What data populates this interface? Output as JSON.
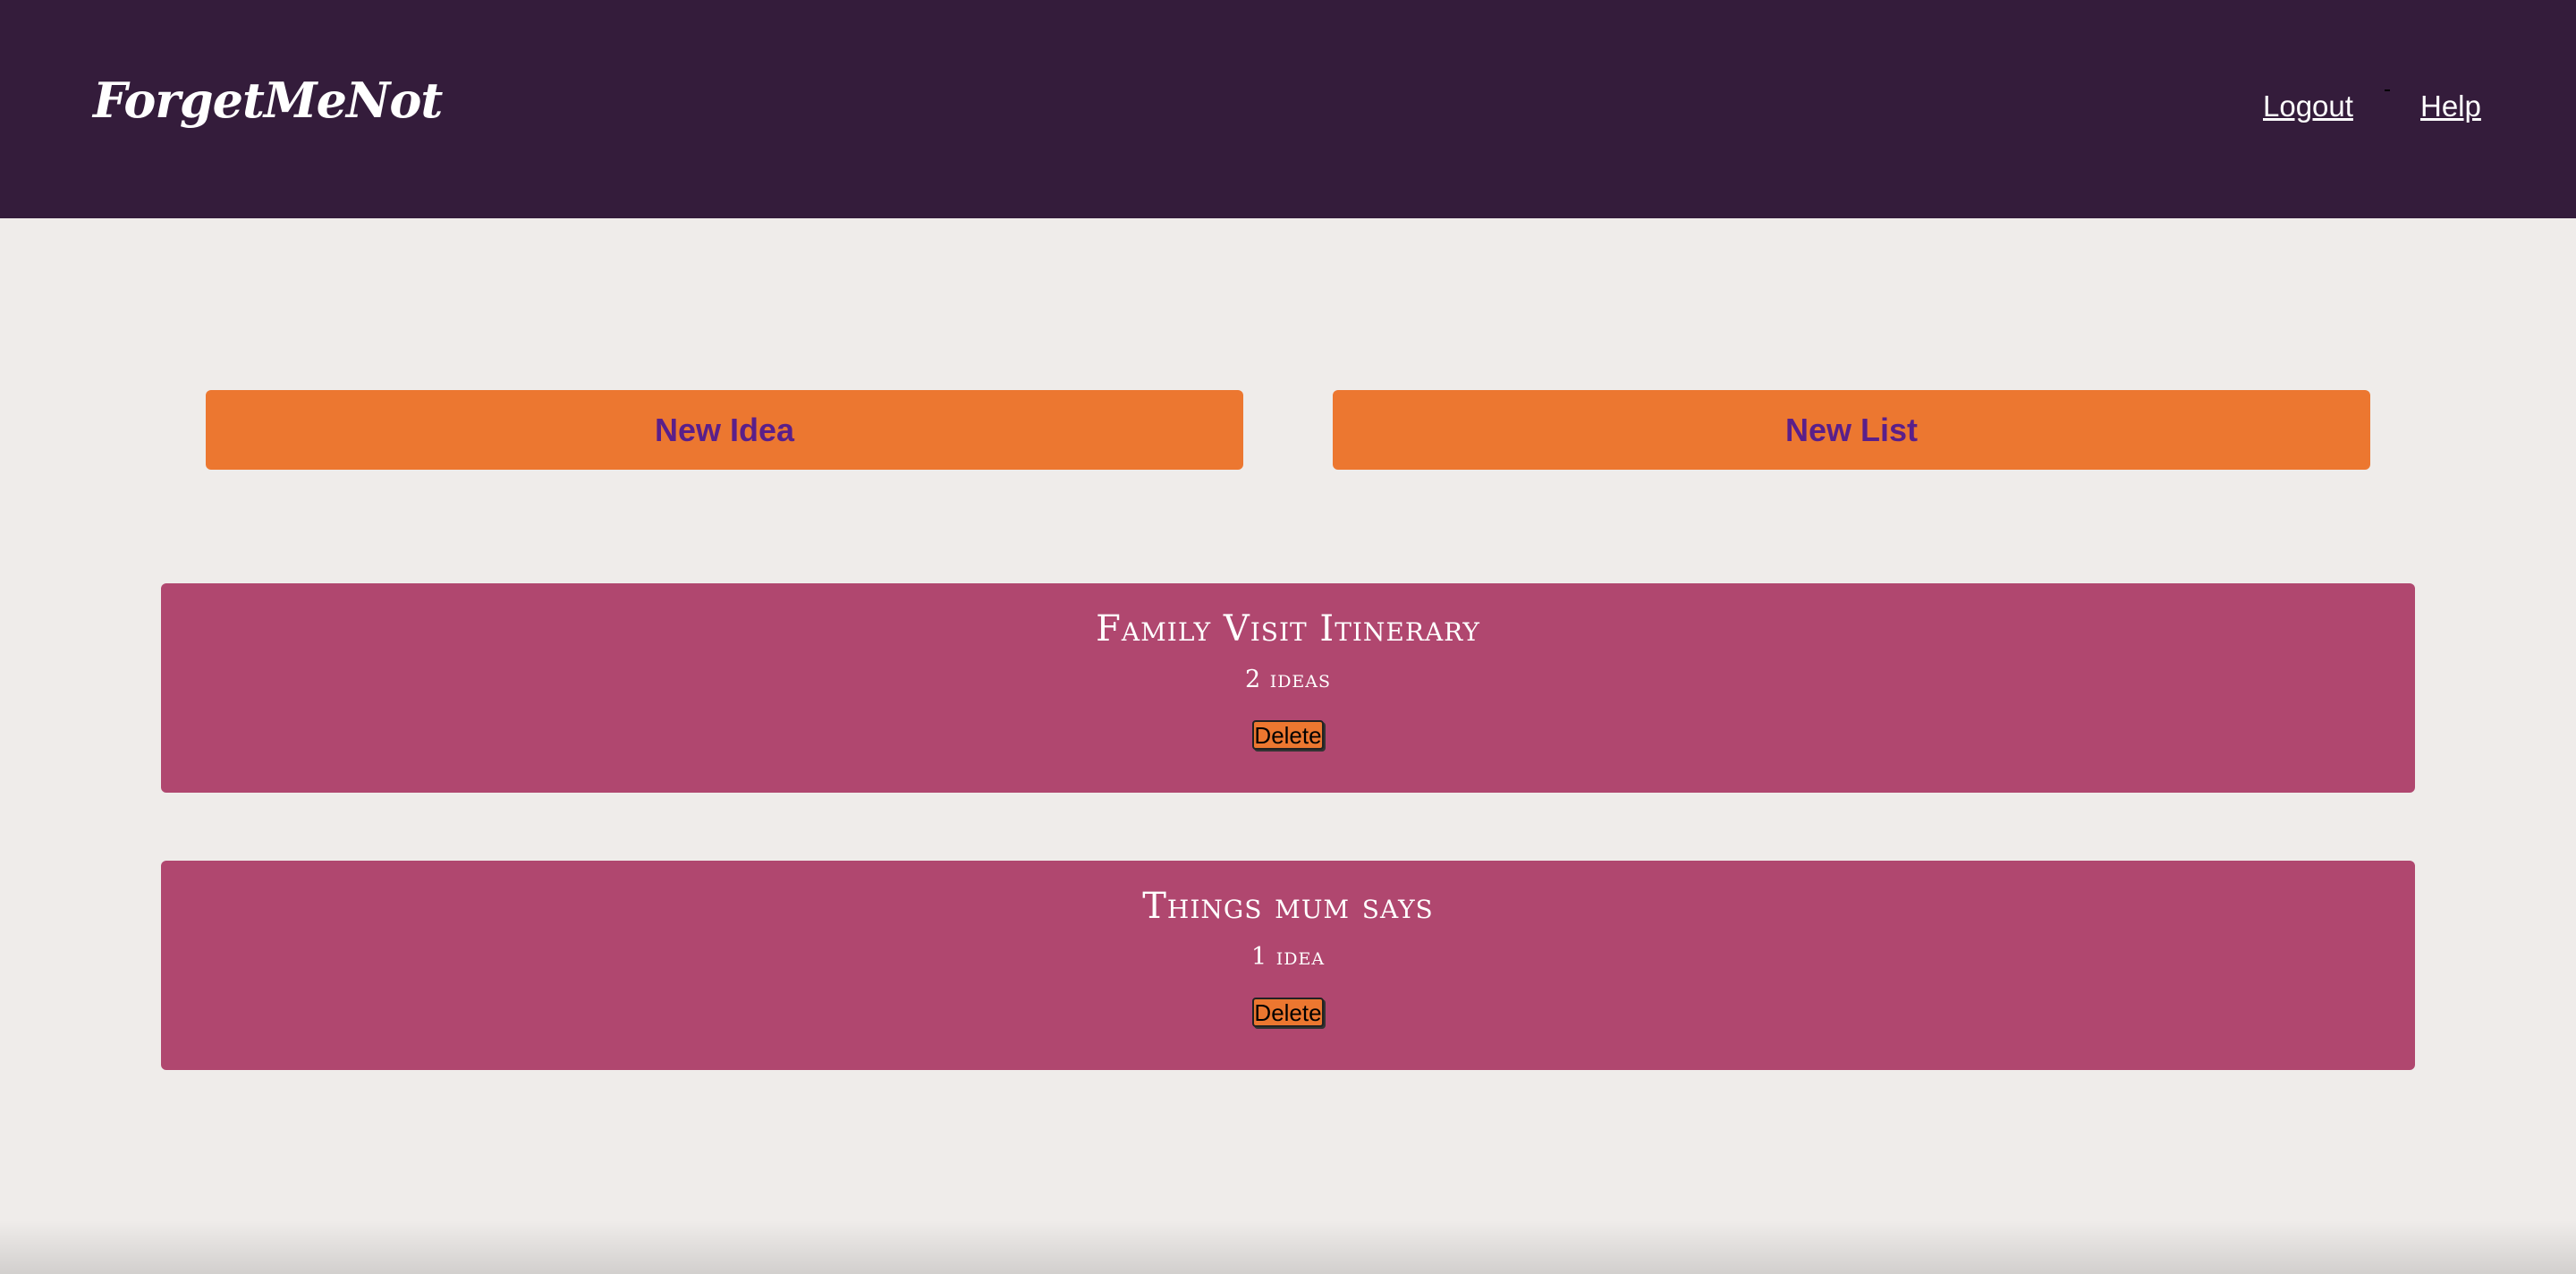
{
  "header": {
    "logo": "ForgetMeNot",
    "nav": {
      "logout": "Logout",
      "help": "Help"
    }
  },
  "actions": {
    "new_idea": "New Idea",
    "new_list": "New List"
  },
  "lists": [
    {
      "title": "Family Visit Itinerary",
      "count": "2 ideas",
      "delete_label": "Delete"
    },
    {
      "title": "Things mum says",
      "count": "1 idea",
      "delete_label": "Delete"
    }
  ],
  "colors": {
    "header_bg": "#341c3b",
    "page_bg": "#efecea",
    "accent_orange": "#ec7730",
    "button_text_purple": "#5a1f8a",
    "card_pink": "#b0476f"
  }
}
